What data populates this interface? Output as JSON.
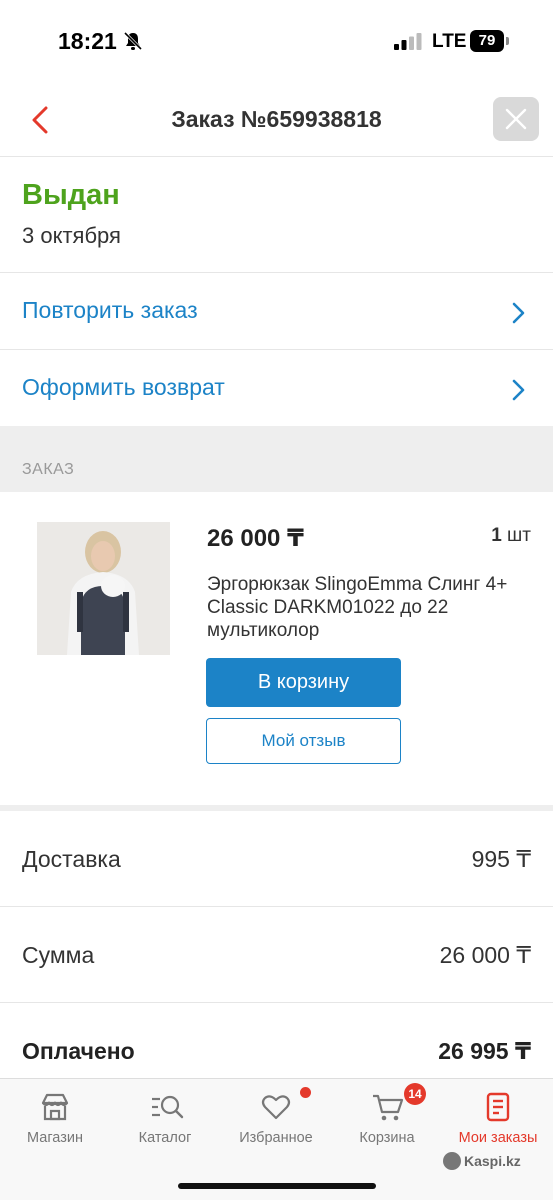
{
  "status_bar": {
    "time": "18:21",
    "network": "LTE",
    "battery": "79"
  },
  "header": {
    "title": "Заказ №659938818"
  },
  "order": {
    "status": "Выдан",
    "date": "3 октября"
  },
  "actions": [
    {
      "label": "Повторить заказ"
    },
    {
      "label": "Оформить возврат"
    }
  ],
  "section": {
    "label": "ЗАКАЗ"
  },
  "product": {
    "price": "26 000 ₸",
    "qty_number": "1",
    "qty_unit": "шт",
    "name": "Эргорюкзак SlingoEmma Слинг 4+ Classic DARKM01022 до 22 мультиколор",
    "cart_button": "В корзину",
    "review_button": "Мой отзыв"
  },
  "summary": [
    {
      "label": "Доставка",
      "value": "995 ₸"
    },
    {
      "label": "Сумма",
      "value": "26 000 ₸"
    },
    {
      "label": "Оплачено",
      "value": "26 995 ₸"
    }
  ],
  "tabs": [
    {
      "label": "Магазин",
      "icon": "store-icon"
    },
    {
      "label": "Каталог",
      "icon": "catalog-search-icon"
    },
    {
      "label": "Избранное",
      "icon": "heart-icon"
    },
    {
      "label": "Корзина",
      "icon": "cart-icon",
      "badge": "14"
    },
    {
      "label": "Мои заказы",
      "icon": "orders-icon",
      "active": true
    }
  ],
  "watermark": "Kaspi.kz",
  "colors": {
    "accent_blue": "#1c83c7",
    "status_green": "#4ea31d",
    "active_red": "#e4392b"
  }
}
